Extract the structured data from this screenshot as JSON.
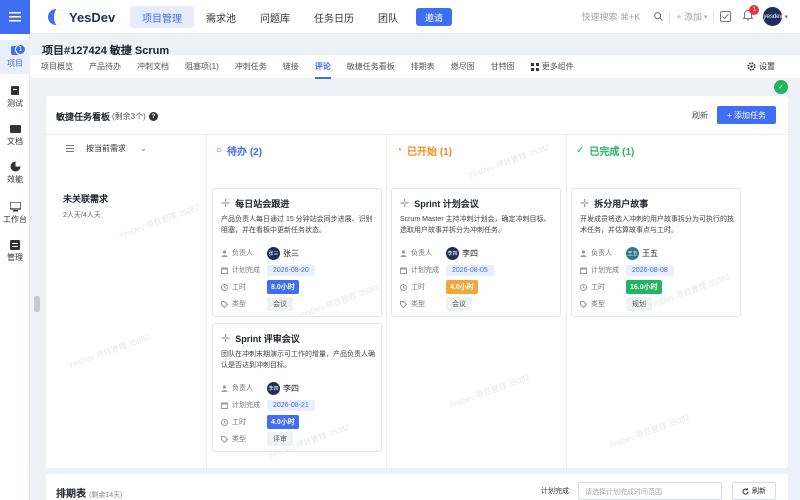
{
  "brand": {
    "name": "YesDev",
    "color": "#3f6df3"
  },
  "leftnav": {
    "badge": "1",
    "items": [
      {
        "label": "项目",
        "icon": "project-icon"
      },
      {
        "label": "测试",
        "icon": "test-icon"
      },
      {
        "label": "文档",
        "icon": "doc-icon"
      },
      {
        "label": "效能",
        "icon": "chart-icon"
      },
      {
        "label": "工作台",
        "icon": "desk-icon"
      },
      {
        "label": "管理",
        "icon": "manage-icon"
      }
    ]
  },
  "topnav": {
    "items": [
      "项目管理",
      "需求池",
      "问题库",
      "任务日历",
      "团队"
    ],
    "invite": "邀请",
    "search": "快速搜索 ⌘+K",
    "add": "+ 添加",
    "notif_count": "1",
    "avatar_text": "yesdev"
  },
  "project": {
    "title": "项目#127424 敏捷 Scrum"
  },
  "subtabs": [
    "项目概览",
    "产品待办",
    "冲刺文档",
    "阻塞项(1)",
    "冲刺任务",
    "链接",
    "评论",
    "敏捷任务看板",
    "排期表",
    "燃尽图",
    "甘特图",
    "更多组件"
  ],
  "settings_label": "设置",
  "board": {
    "title": "敏捷任务看板",
    "hint": "(剩余3个)",
    "refresh": "刷新",
    "add": "+ 添加任务",
    "group_selector": "按当前需求",
    "columns": [
      {
        "title": "待办 (2)",
        "color": "#3f6df3",
        "icon": "○"
      },
      {
        "title": "已开始 (1)",
        "color": "#f08c1a",
        "icon": "◔"
      },
      {
        "title": "已完成 (1)",
        "color": "#20b463",
        "icon": "✓"
      }
    ],
    "group": {
      "title": "未关联需求",
      "sub": "2人天/4人天"
    },
    "field_labels": {
      "owner": "负责人",
      "due": "计划完成",
      "hours": "工时",
      "type": "类型"
    },
    "cards": [
      {
        "title": "每日站会跟进",
        "desc": "产品负责人每日通过 15 分钟站会同步进展、识别阻塞，并在看板中更新任务状态。",
        "owner": "张三",
        "owner_short": "张三",
        "due": "2026-08-20",
        "hours": "8.0小时",
        "hours_color": "#3f6df3",
        "type": "会议"
      },
      {
        "title": "Sprint 评审会议",
        "desc": "团队在冲刺末期演示可工作的增量，产品负责人确认是否达到冲刺目标。",
        "owner": "李四",
        "owner_short": "李四",
        "due": "2026-08-21",
        "hours": "4.0小时",
        "hours_color": "#3f6df3",
        "type": "评审"
      },
      {
        "title": "Sprint 计划会议",
        "desc": "Scrum Master 主持冲刺计划会，确定冲刺目标、选取用户故事并拆分为冲刺任务。",
        "owner": "李四",
        "owner_short": "李四",
        "due": "2026-08-05",
        "hours": "4.0小时",
        "hours_color": "#f0a83c",
        "type": "会议"
      },
      {
        "title": "拆分用户故事",
        "desc": "开发成员将选入冲刺的用户故事拆分为可执行的技术任务，并估算故事点与工时。",
        "owner": "王五",
        "owner_short": "王五",
        "due": "2026-08-08",
        "hours": "16.0小时",
        "hours_color": "#20b463",
        "type": "规划"
      }
    ]
  },
  "schedule": {
    "title": "排期表",
    "hint": "(剩余14天)",
    "label": "计划完成:",
    "placeholder": "请选择计划完成时间范围",
    "refresh": "刷新"
  },
  "watermark": "YesDev 项目管理 35082"
}
